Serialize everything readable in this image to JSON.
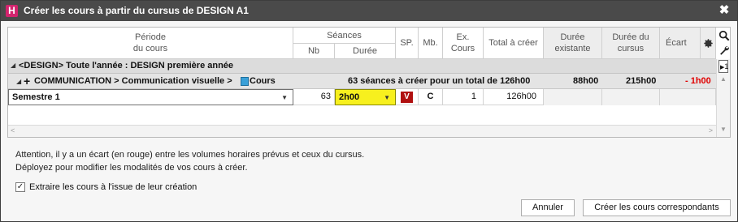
{
  "app": {
    "icon_letter": "H",
    "title": "Créer les cours à partir du cursus de DESIGN A1",
    "close_glyph": "✖"
  },
  "columns": {
    "periode": "Période\ndu cours",
    "seances": "Séances",
    "nb": "Nb",
    "duree": "Durée",
    "sp": "SP.",
    "mb": "Mb.",
    "ex_cours": "Ex.\nCours",
    "total": "Total à créer",
    "duree_existante": "Durée\nexistante",
    "duree_cursus": "Durée du\ncursus",
    "ecart": "Écart"
  },
  "group": {
    "toggle_glyph": "◢",
    "label": "<DESIGN> Toute l'année : DESIGN première année"
  },
  "subgroup": {
    "toggle_glyph": "◢",
    "plus_glyph": "+",
    "path": "COMMUNICATION > Communication visuelle >",
    "cours_label": "Cours",
    "summary": "63 séances à créer pour un total de 126h00",
    "duree_existante": "88h00",
    "duree_cursus": "215h00",
    "ecart": "- 1h00"
  },
  "row": {
    "periode": "Semestre 1",
    "nb": "63",
    "duree": "2h00",
    "sp": "V",
    "mb": "C",
    "ex_cours": "1",
    "total": "126h00"
  },
  "side": {
    "page_indicator": "1"
  },
  "messages": {
    "line1": "Attention, il y a un écart (en rouge) entre les volumes horaires prévus et ceux du cursus.",
    "line2": "Déployez pour modifier les modalités de vos cours à créer."
  },
  "extract_option": {
    "checked": true,
    "check_glyph": "✓",
    "label": "Extraire les cours à l'issue de leur création"
  },
  "buttons": {
    "cancel": "Annuler",
    "create": "Créer les cours correspondants"
  },
  "colors": {
    "accent": "#d3246e",
    "ecart_red": "#e00000",
    "sp_badge": "#b01010",
    "duree_highlight": "#f7f01e",
    "cours_square": "#3aa0d8"
  }
}
